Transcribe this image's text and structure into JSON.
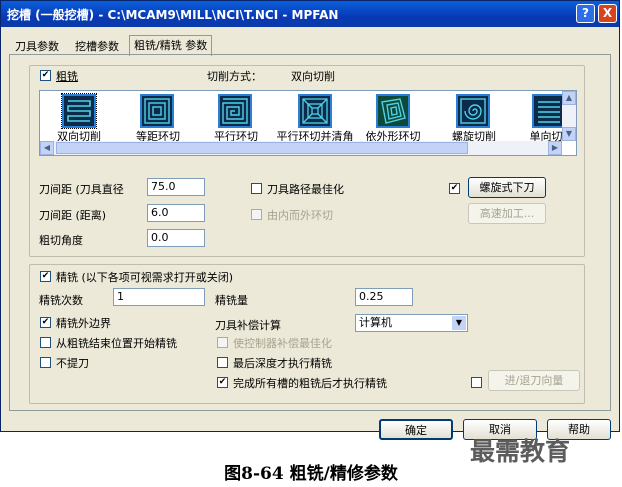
{
  "window": {
    "title": "挖槽 (一般挖槽) - C:\\MCAM9\\MILL\\NCI\\T.NCI - MPFAN",
    "help_glyph": "?",
    "close_glyph": "X"
  },
  "tabs": [
    {
      "label": "刀具参数"
    },
    {
      "label": "挖槽参数"
    },
    {
      "label": "粗铣/精铣 参数",
      "selected": true
    }
  ],
  "rough": {
    "enabled_label": "粗铣",
    "enabled": true,
    "cut_method_label": "切削方式：",
    "cut_method_value": "双向切削",
    "patterns": [
      {
        "label": "双向切削",
        "icon": "zigzag-pattern-icon",
        "selected": true
      },
      {
        "label": "等距环切",
        "icon": "constant-overlap-spiral-icon"
      },
      {
        "label": "平行环切",
        "icon": "parallel-spiral-icon"
      },
      {
        "label": "平行环切并清角",
        "icon": "parallel-spiral-clean-corners-icon"
      },
      {
        "label": "依外形环切",
        "icon": "morph-spiral-icon"
      },
      {
        "label": "螺旋切削",
        "icon": "true-spiral-icon"
      },
      {
        "label": "单向切",
        "icon": "one-way-pattern-icon"
      }
    ],
    "stepover_label": "刀间距 (刀具直径",
    "stepover_percent": "75.0",
    "stepover_dist_label": "刀间距 (距离)",
    "stepover_dist": "6.0",
    "angle_label": "粗切角度",
    "angle": "0.0",
    "minimize_label": "刀具路径最佳化",
    "minimize": false,
    "spiral_inside_out_label": "由内而外环切",
    "spiral_inside_out": false,
    "ramp_checked": true,
    "ramp_button": "螺旋式下刀",
    "hst_button": "高速加工..."
  },
  "finish": {
    "enabled_label": "精铣 (以下各项可视需求打开或关闭)",
    "enabled": true,
    "passes_label": "精铣次数",
    "passes": "1",
    "spacing_label": "精铣量",
    "spacing": "0.25",
    "outer_label": "精铣外边界",
    "outer": true,
    "start_label": "从粗铣结束位置开始精铣",
    "start": false,
    "keep_tool_down_label": "不提刀",
    "keep_tool_down": false,
    "comp_label": "刀具补偿计算",
    "comp_value": "计算机",
    "optimize_label": "使控制器补偿最佳化",
    "optimize": false,
    "last_depth_label": "最后深度才执行精铣",
    "last_depth": false,
    "after_all_label": "完成所有槽的粗铣后才执行精铣",
    "after_all": true,
    "leadinout_checked": false,
    "leadinout_button": "进/退刀向量"
  },
  "dialog_buttons": {
    "ok": "确定",
    "cancel": "取消",
    "help": "帮助"
  },
  "caption": "图8-64 粗铣/精修参数",
  "watermark": "最需教育",
  "colors": {
    "titlebar": "#0a5fdb",
    "window_bg": "#ece9d8",
    "pattern_icon_bg": "#0c2a4a",
    "pattern_icon_stroke": "#4fd1e8"
  }
}
